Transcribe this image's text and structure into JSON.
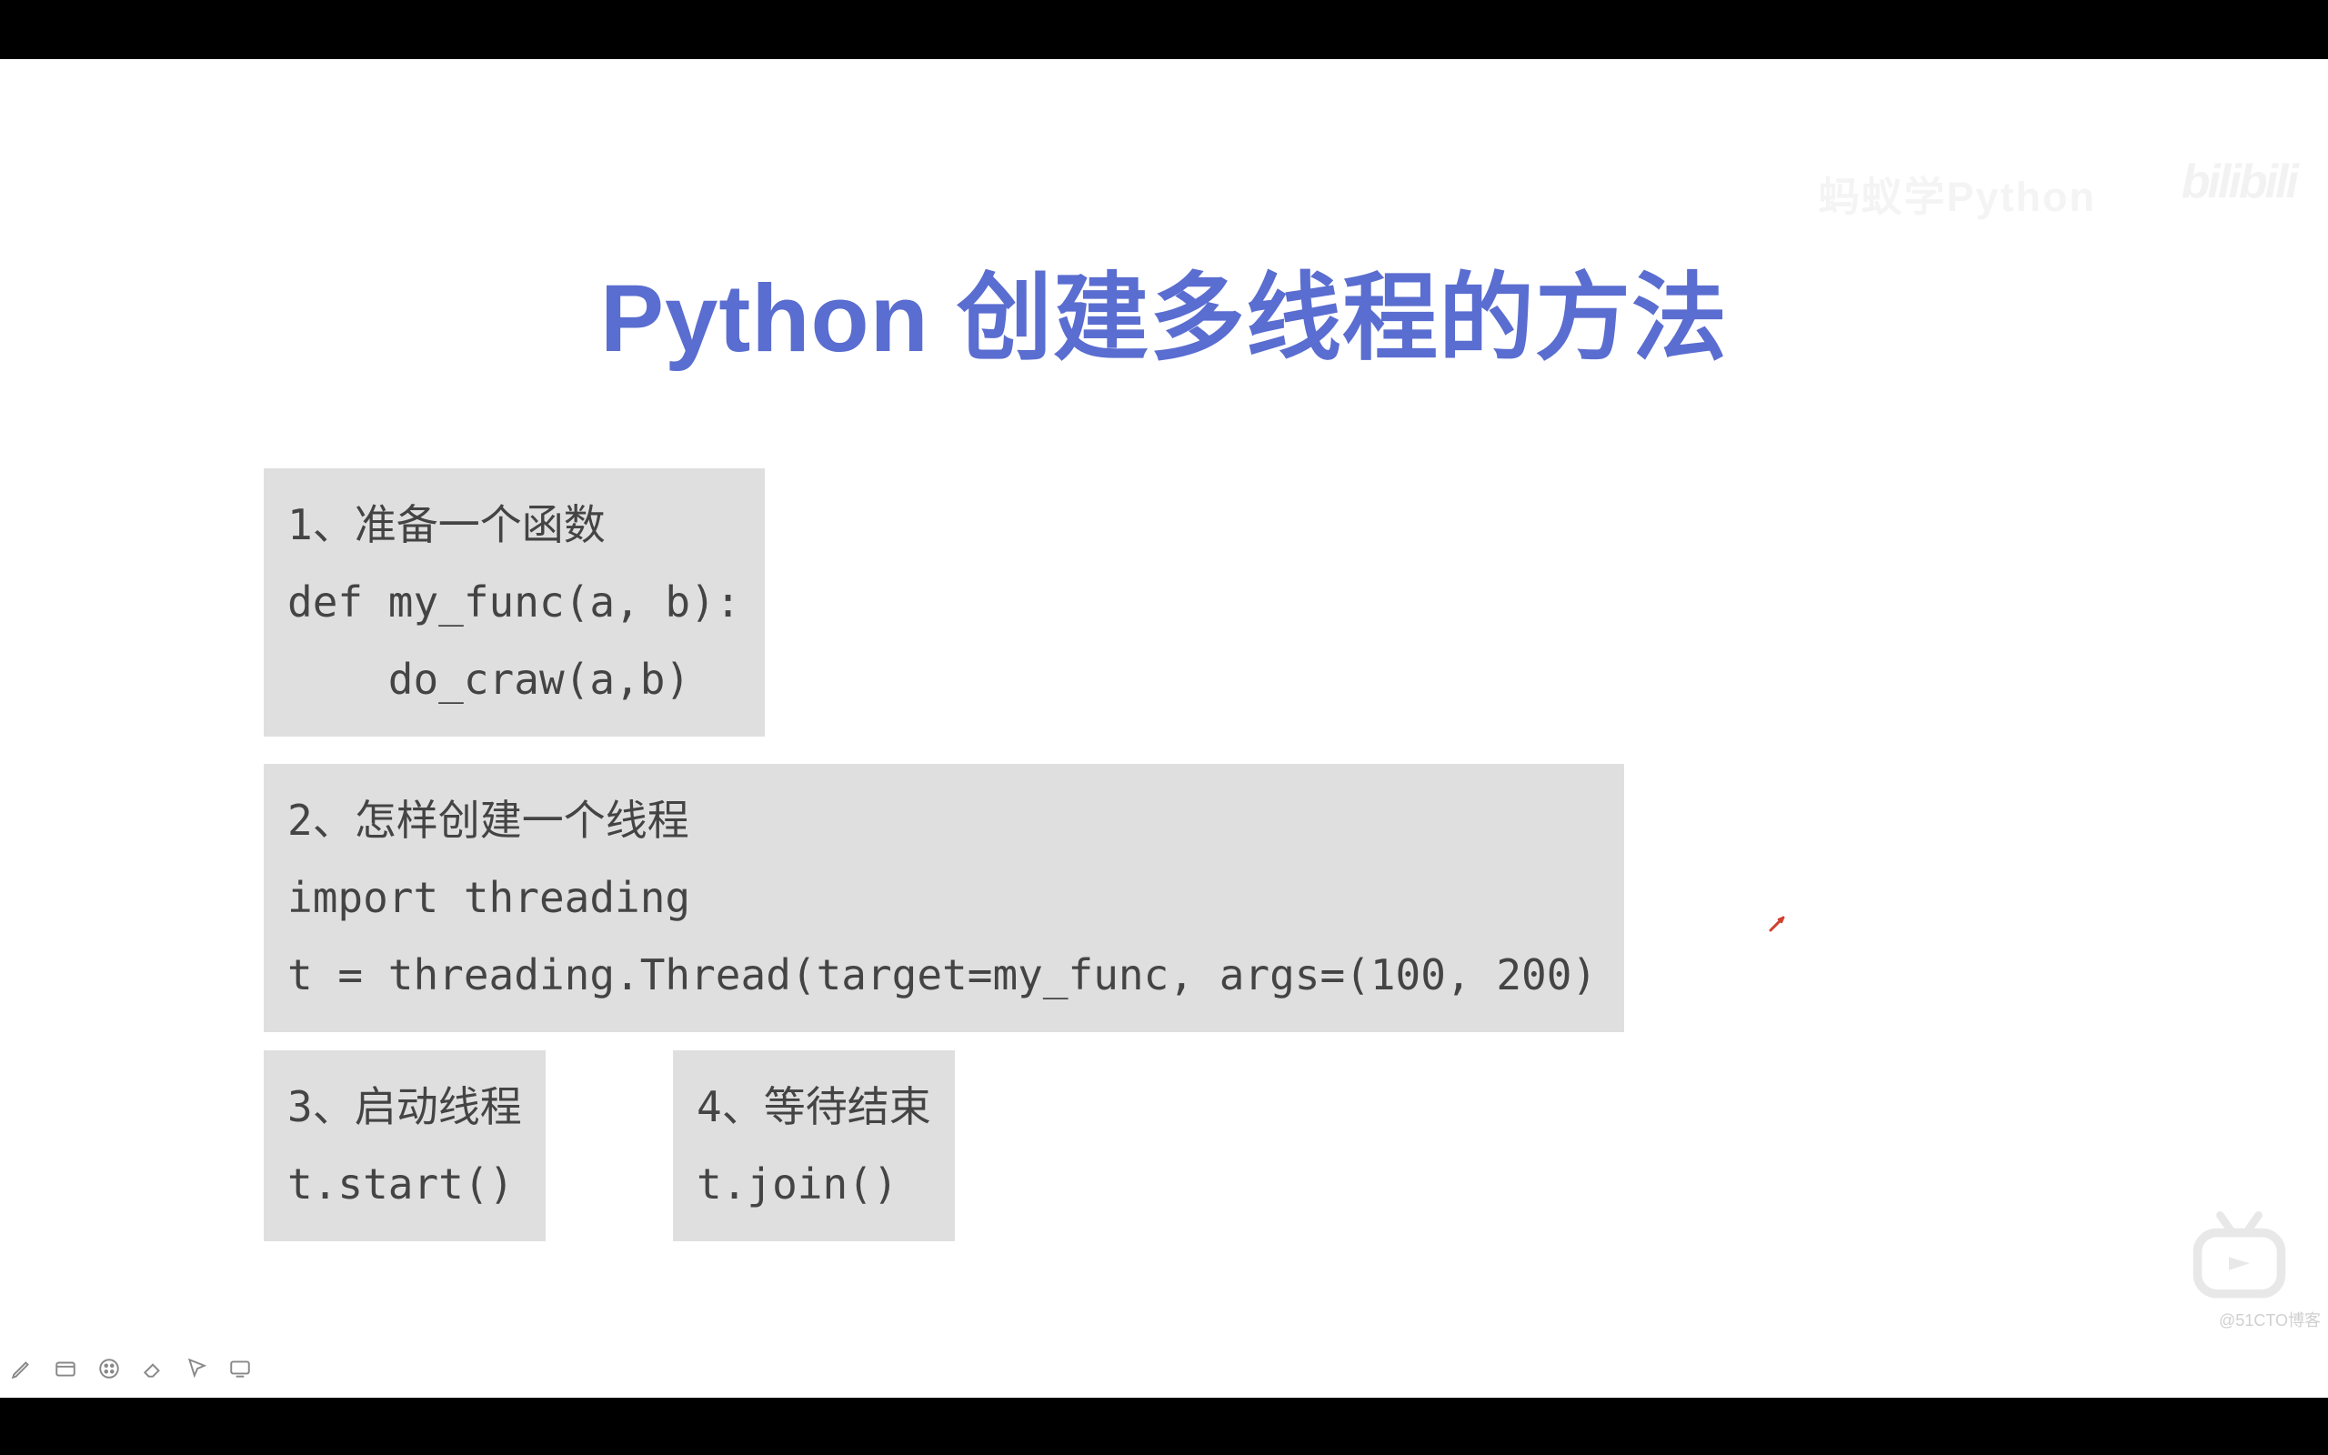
{
  "title": "Python 创建多线程的方法",
  "watermark_left": "蚂蚁学Python",
  "watermark_right": "bilibili",
  "blocks": {
    "block1": "1、准备一个函数\ndef my_func(a, b):\n    do_craw(a,b)",
    "block2": "2、怎样创建一个线程\nimport threading\nt = threading.Thread(target=my_func, args=(100, 200)",
    "block3": "3、启动线程\nt.start()",
    "block4": "4、等待结束\nt.join()"
  },
  "footer": "@51CTO博客"
}
